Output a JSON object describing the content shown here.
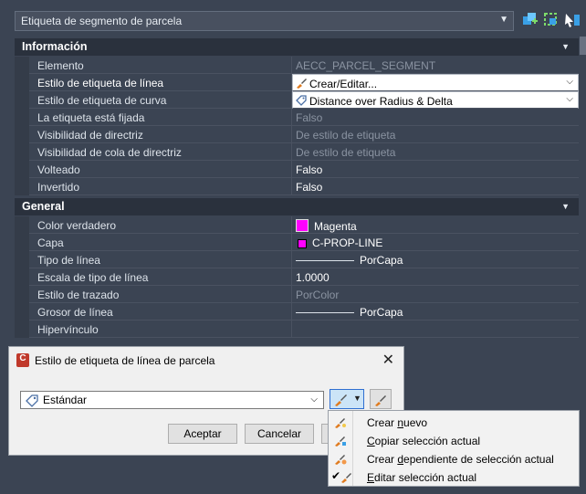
{
  "top": {
    "selector_value": "Etiqueta de segmento de parcela"
  },
  "sections": {
    "informacion": {
      "title": "Información",
      "rows": [
        {
          "label": "Elemento",
          "value": "AECC_PARCEL_SEGMENT"
        },
        {
          "label": "Estilo de etiqueta de línea",
          "value": "Crear/Editar..."
        },
        {
          "label": "Estilo de etiqueta de curva",
          "value": "Distance over Radius & Delta"
        },
        {
          "label": "La etiqueta está fijada",
          "value": "Falso"
        },
        {
          "label": "Visibilidad de directriz",
          "value": "De estilo de etiqueta"
        },
        {
          "label": "Visibilidad de cola de directriz",
          "value": "De estilo de etiqueta"
        },
        {
          "label": "Volteado",
          "value": "Falso"
        },
        {
          "label": "Invertido",
          "value": "Falso"
        }
      ]
    },
    "general": {
      "title": "General",
      "rows": [
        {
          "label": "Color verdadero",
          "value": "Magenta"
        },
        {
          "label": "Capa",
          "value": "C-PROP-LINE"
        },
        {
          "label": "Tipo de línea",
          "value": "PorCapa"
        },
        {
          "label": "Escala de tipo de línea",
          "value": "1.0000"
        },
        {
          "label": "Estilo de trazado",
          "value": "PorColor"
        },
        {
          "label": "Grosor de línea",
          "value": "PorCapa"
        },
        {
          "label": "Hipervínculo",
          "value": ""
        }
      ]
    }
  },
  "dialog": {
    "title": "Estilo de etiqueta de línea de parcela",
    "app_badge": "C",
    "style_value": "Estándar",
    "accept_label": "Aceptar",
    "cancel_label": "Cancelar"
  },
  "menu": {
    "items": [
      {
        "pre": "Crear ",
        "ul": "n",
        "post": "uevo"
      },
      {
        "pre": "",
        "ul": "C",
        "post": "opiar selección actual"
      },
      {
        "pre": "Crear ",
        "ul": "d",
        "post": "ependiente de selección actual"
      },
      {
        "pre": "",
        "ul": "E",
        "post": "ditar selección actual"
      }
    ]
  },
  "colors": {
    "magenta": "#ff00ff",
    "accent_blue": "#2f6fd1"
  }
}
